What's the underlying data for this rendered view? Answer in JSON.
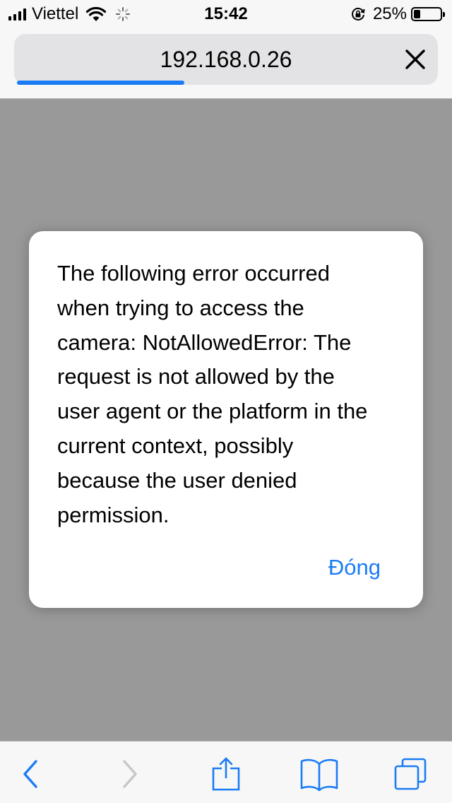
{
  "status_bar": {
    "carrier": "Viettel",
    "time": "15:42",
    "battery_percent": "25%",
    "battery_level": 0.25,
    "icons": [
      "signal-icon",
      "wifi-icon",
      "activity-spinner-icon",
      "rotation-lock-icon",
      "battery-icon"
    ]
  },
  "browser": {
    "url": "192.168.0.26",
    "load_progress": 0.4,
    "stop_icon": "close-icon"
  },
  "alert": {
    "message": "The following error occurred when trying to access the camera: NotAllowedError: The request is not allowed by the user agent or the platform in the current context, possibly because the user denied permission.",
    "button_label": "Đóng"
  },
  "toolbar": {
    "items": [
      "back-icon",
      "forward-icon",
      "share-icon",
      "bookmarks-icon",
      "tabs-icon"
    ]
  },
  "colors": {
    "accent": "#1a7cf5",
    "dim_overlay": "#999999",
    "bar_background": "#f7f7f7",
    "disabled_icon": "#c7c7cc"
  }
}
